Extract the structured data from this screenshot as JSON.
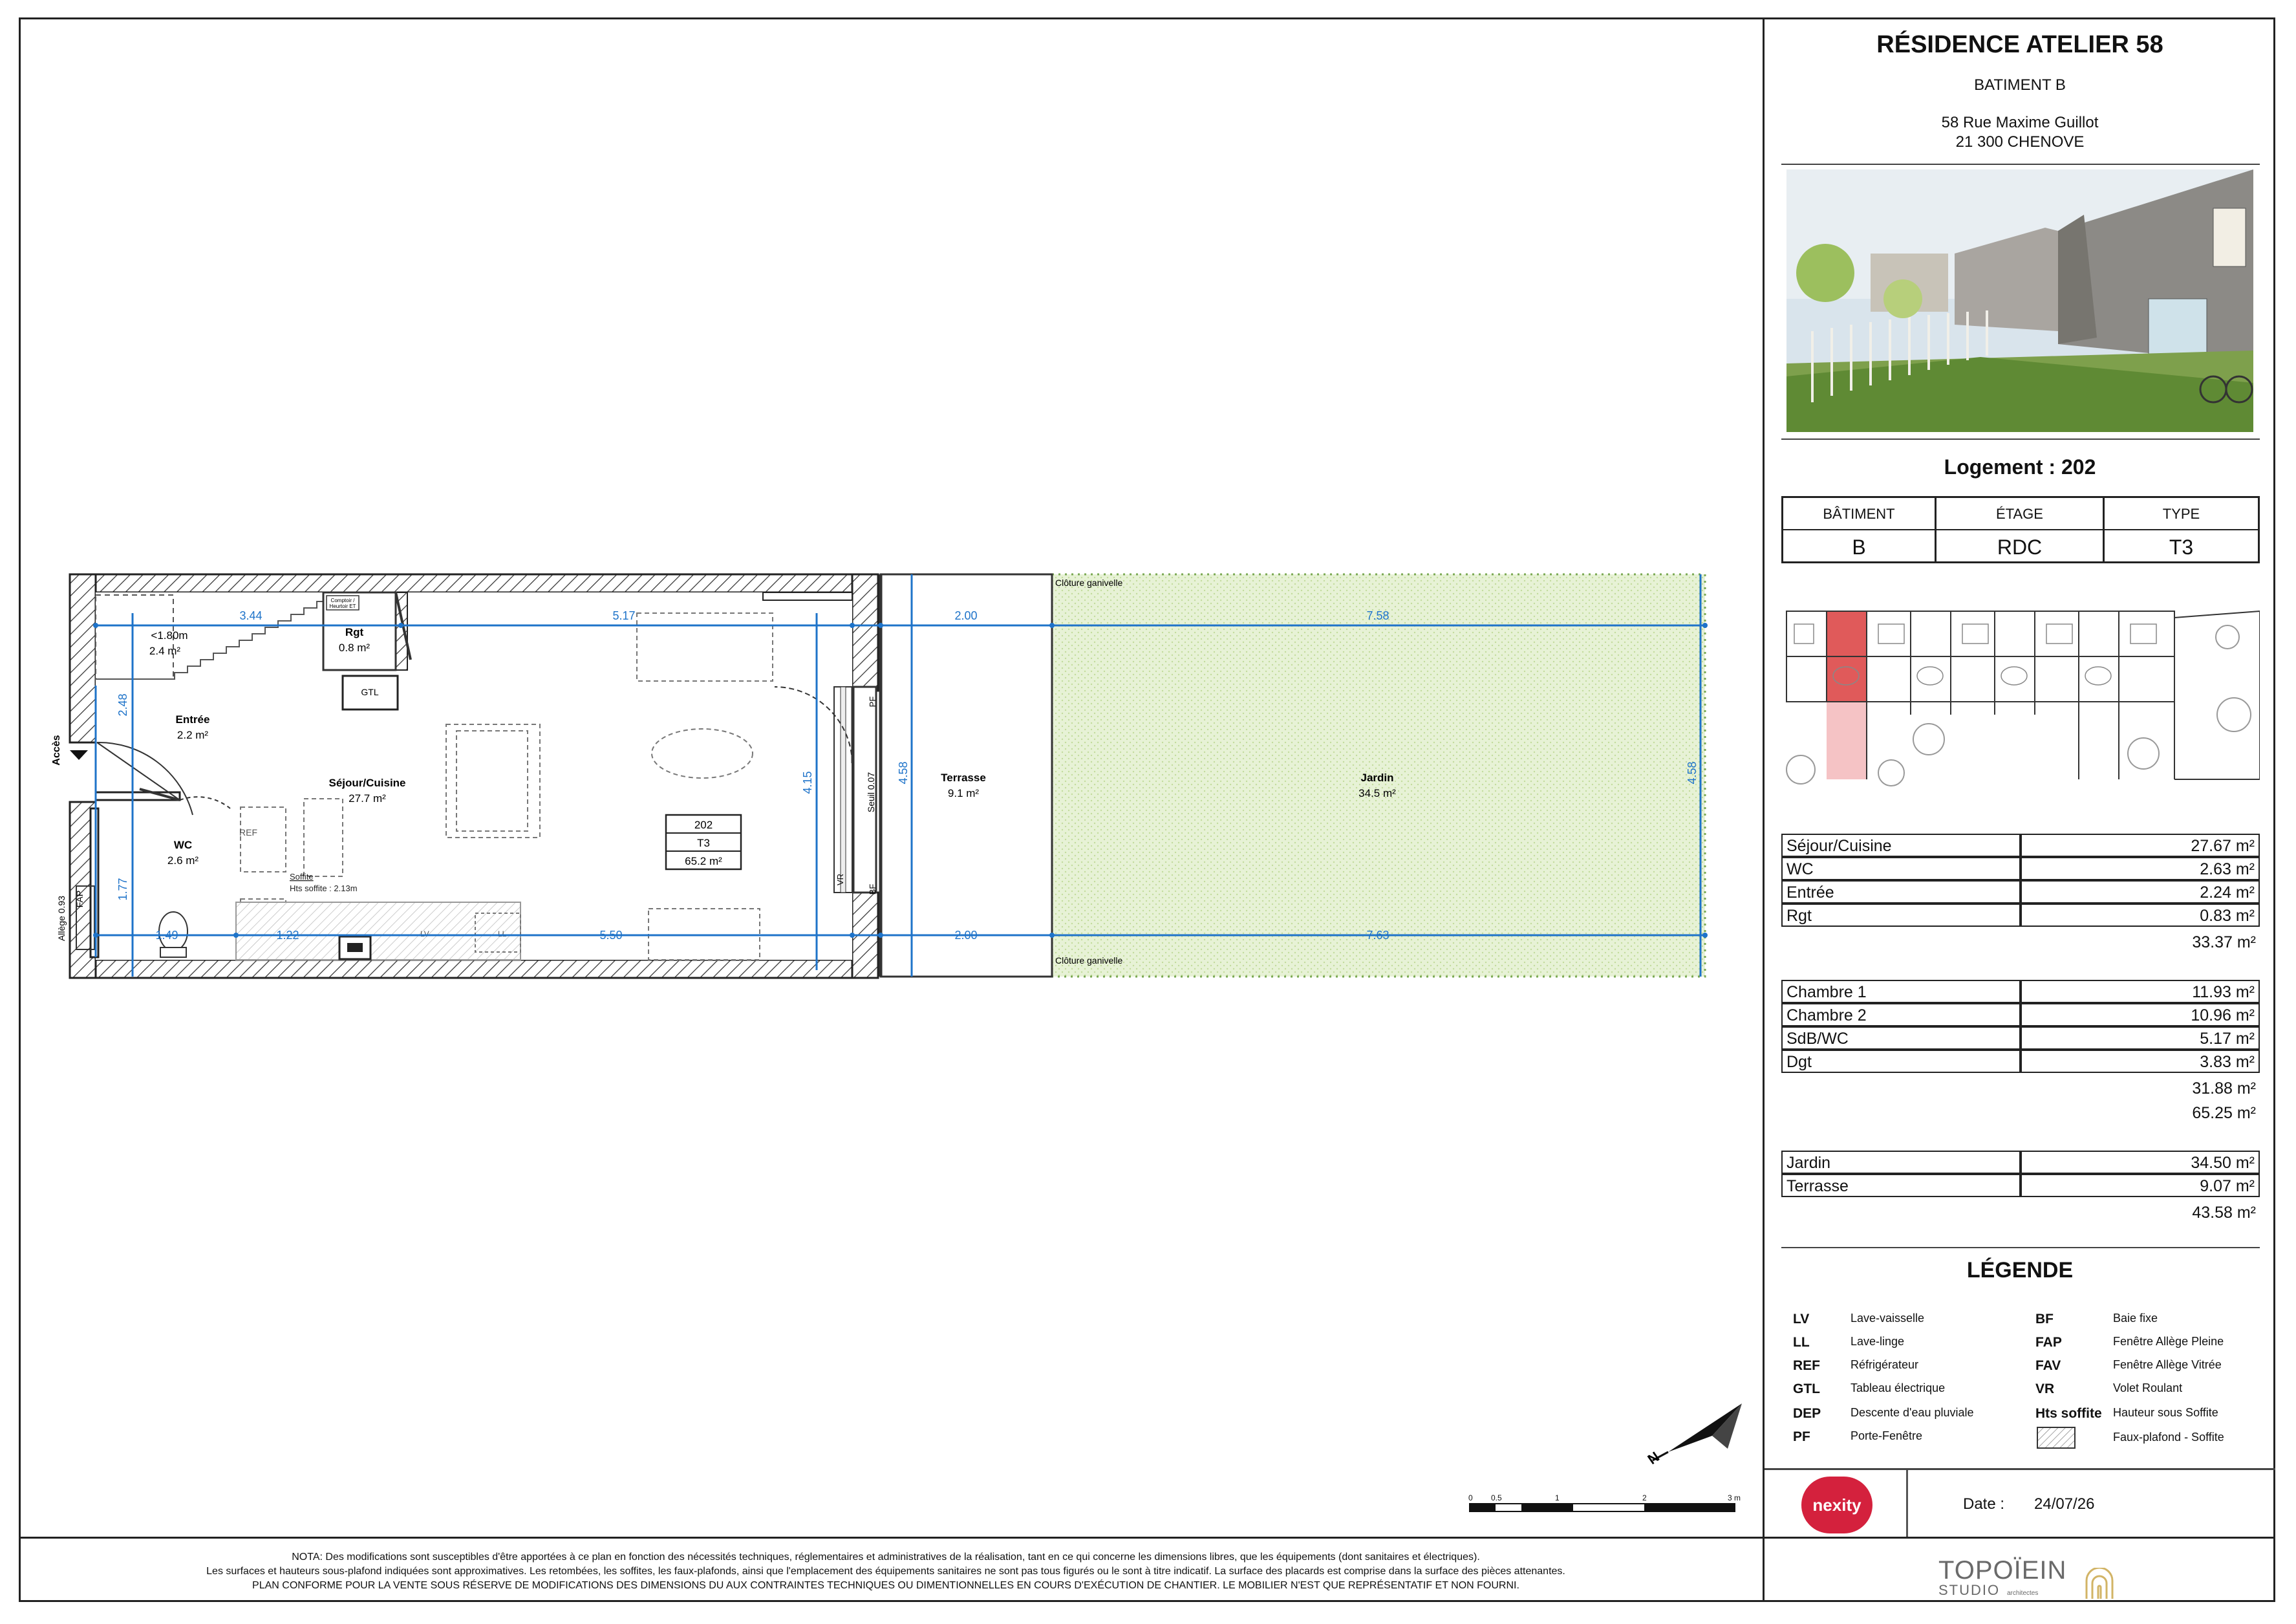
{
  "header": {
    "project": "RÉSIDENCE ATELIER 58",
    "building": "BATIMENT B",
    "address_line1": "58 Rue Maxime Guillot",
    "address_line2": "21 300 CHENOVE",
    "logement": "Logement : 202"
  },
  "info_table": {
    "headers": [
      "BÂTIMENT",
      "ÉTAGE",
      "TYPE"
    ],
    "values": [
      "B",
      "RDC",
      "T3"
    ]
  },
  "areas": {
    "group1": [
      {
        "label": "Séjour/Cuisine",
        "value": "27.67 m²"
      },
      {
        "label": "WC",
        "value": "2.63 m²"
      },
      {
        "label": "Entrée",
        "value": "2.24 m²"
      },
      {
        "label": "Rgt",
        "value": "0.83 m²"
      }
    ],
    "group1_total": "33.37 m²",
    "group2": [
      {
        "label": "Chambre 1",
        "value": "11.93 m²"
      },
      {
        "label": "Chambre 2",
        "value": "10.96 m²"
      },
      {
        "label": "SdB/WC",
        "value": "5.17 m²"
      },
      {
        "label": "Dgt",
        "value": "3.83 m²"
      }
    ],
    "group2_total": "31.88 m²",
    "grand_total": "65.25 m²",
    "group3": [
      {
        "label": "Jardin",
        "value": "34.50 m²"
      },
      {
        "label": "Terrasse",
        "value": "9.07 m²"
      }
    ],
    "group3_total": "43.58 m²"
  },
  "legend": {
    "title": "LÉGENDE",
    "left": [
      {
        "abbr": "LV",
        "text": "Lave-vaisselle"
      },
      {
        "abbr": "LL",
        "text": "Lave-linge"
      },
      {
        "abbr": "REF",
        "text": "Réfrigérateur"
      },
      {
        "abbr": "GTL",
        "text": "Tableau électrique"
      },
      {
        "abbr": "DEP",
        "text": "Descente d'eau pluviale"
      },
      {
        "abbr": "PF",
        "text": "Porte-Fenêtre"
      }
    ],
    "right": [
      {
        "abbr": "BF",
        "text": "Baie fixe"
      },
      {
        "abbr": "FAP",
        "text": "Fenêtre Allège Pleine"
      },
      {
        "abbr": "FAV",
        "text": "Fenêtre Allège Vitrée"
      },
      {
        "abbr": "VR",
        "text": "Volet Roulant"
      },
      {
        "abbr": "Hts soffite",
        "text": "Hauteur sous Soffite"
      },
      {
        "abbr": "",
        "text": "Faux-plafond - Soffite"
      }
    ]
  },
  "footer": {
    "brand": "nexity",
    "date_label": "Date :",
    "date_value": "24/07/26",
    "studio_line1": "TOPOÏEIN",
    "studio_line2": "STUDIO",
    "studio_sub": "architectes"
  },
  "notes": [
    "NOTA: Des modifications sont susceptibles d'être apportées à ce plan en fonction des nécessités techniques, réglementaires et administratives de la réalisation, tant en ce qui concerne les dimensions libres, que les équipements (dont sanitaires et électriques).",
    "Les surfaces et hauteurs sous-plafond indiquées sont approximatives. Les retombées, les soffites, les faux-plafonds, ainsi que l'emplacement des équipements sanitaires ne sont pas tous figurés ou le sont à titre indicatif. La surface des placards est comprise dans la surface des pièces attenantes.",
    "PLAN CONFORME POUR LA VENTE SOUS RÉSERVE DE MODIFICATIONS DES DIMENSIONS DU AUX CONTRAINTES TECHNIQUES OU DIMENTIONNELLES EN COURS D'EXÉCUTION DE CHANTIER. LE MOBILIER N'EST QUE REPRÉSENTATIF ET NON FOURNI."
  ],
  "plan": {
    "rooms": [
      {
        "name": "Séjour/Cuisine",
        "area": "27.7 m²"
      },
      {
        "name": "Entrée",
        "area": "2.2 m²"
      },
      {
        "name": "WC",
        "area": "2.6 m²"
      },
      {
        "name": "Rgt",
        "area": "0.8 m²"
      },
      {
        "name": "Terrasse",
        "area": "9.1 m²"
      },
      {
        "name": "Jardin",
        "area": "34.5 m²"
      }
    ],
    "stair_label": "<1.80m",
    "stair_area": "2.4 m²",
    "unit_tag": [
      "202",
      "T3",
      "65.2 m²"
    ],
    "dims": {
      "d344": "3.44",
      "d517": "5.17",
      "d200a": "2.00",
      "d758": "7.58",
      "d550": "5.50",
      "d122": "1.22",
      "d149": "1.49",
      "d200b": "2.00",
      "d763": "7.63",
      "d248": "2.48",
      "d177": "1.77",
      "d415": "4.15",
      "d458a": "4.58",
      "d458b": "4.58"
    },
    "labels": {
      "acces": "Accès",
      "allege": "Allège 0.93",
      "fap": "FAP",
      "cloture_top": "Clôture ganivelle",
      "cloture_bottom": "Clôture ganivelle",
      "seuil": "Seuil 0.07",
      "pf": "PF",
      "bf": "BF",
      "vr": "VR",
      "soffite": "Soffite",
      "hts_soffite": "Hts soffite : 2.13m",
      "ref": "REF",
      "gtl": "GTL",
      "lv": "LV",
      "ll": "LL",
      "comptoir": "Comptoir /",
      "comptoir2": "Heurtoir ET"
    },
    "scale_ticks": [
      "0",
      "0.5",
      "1",
      "2",
      "3 m"
    ]
  }
}
